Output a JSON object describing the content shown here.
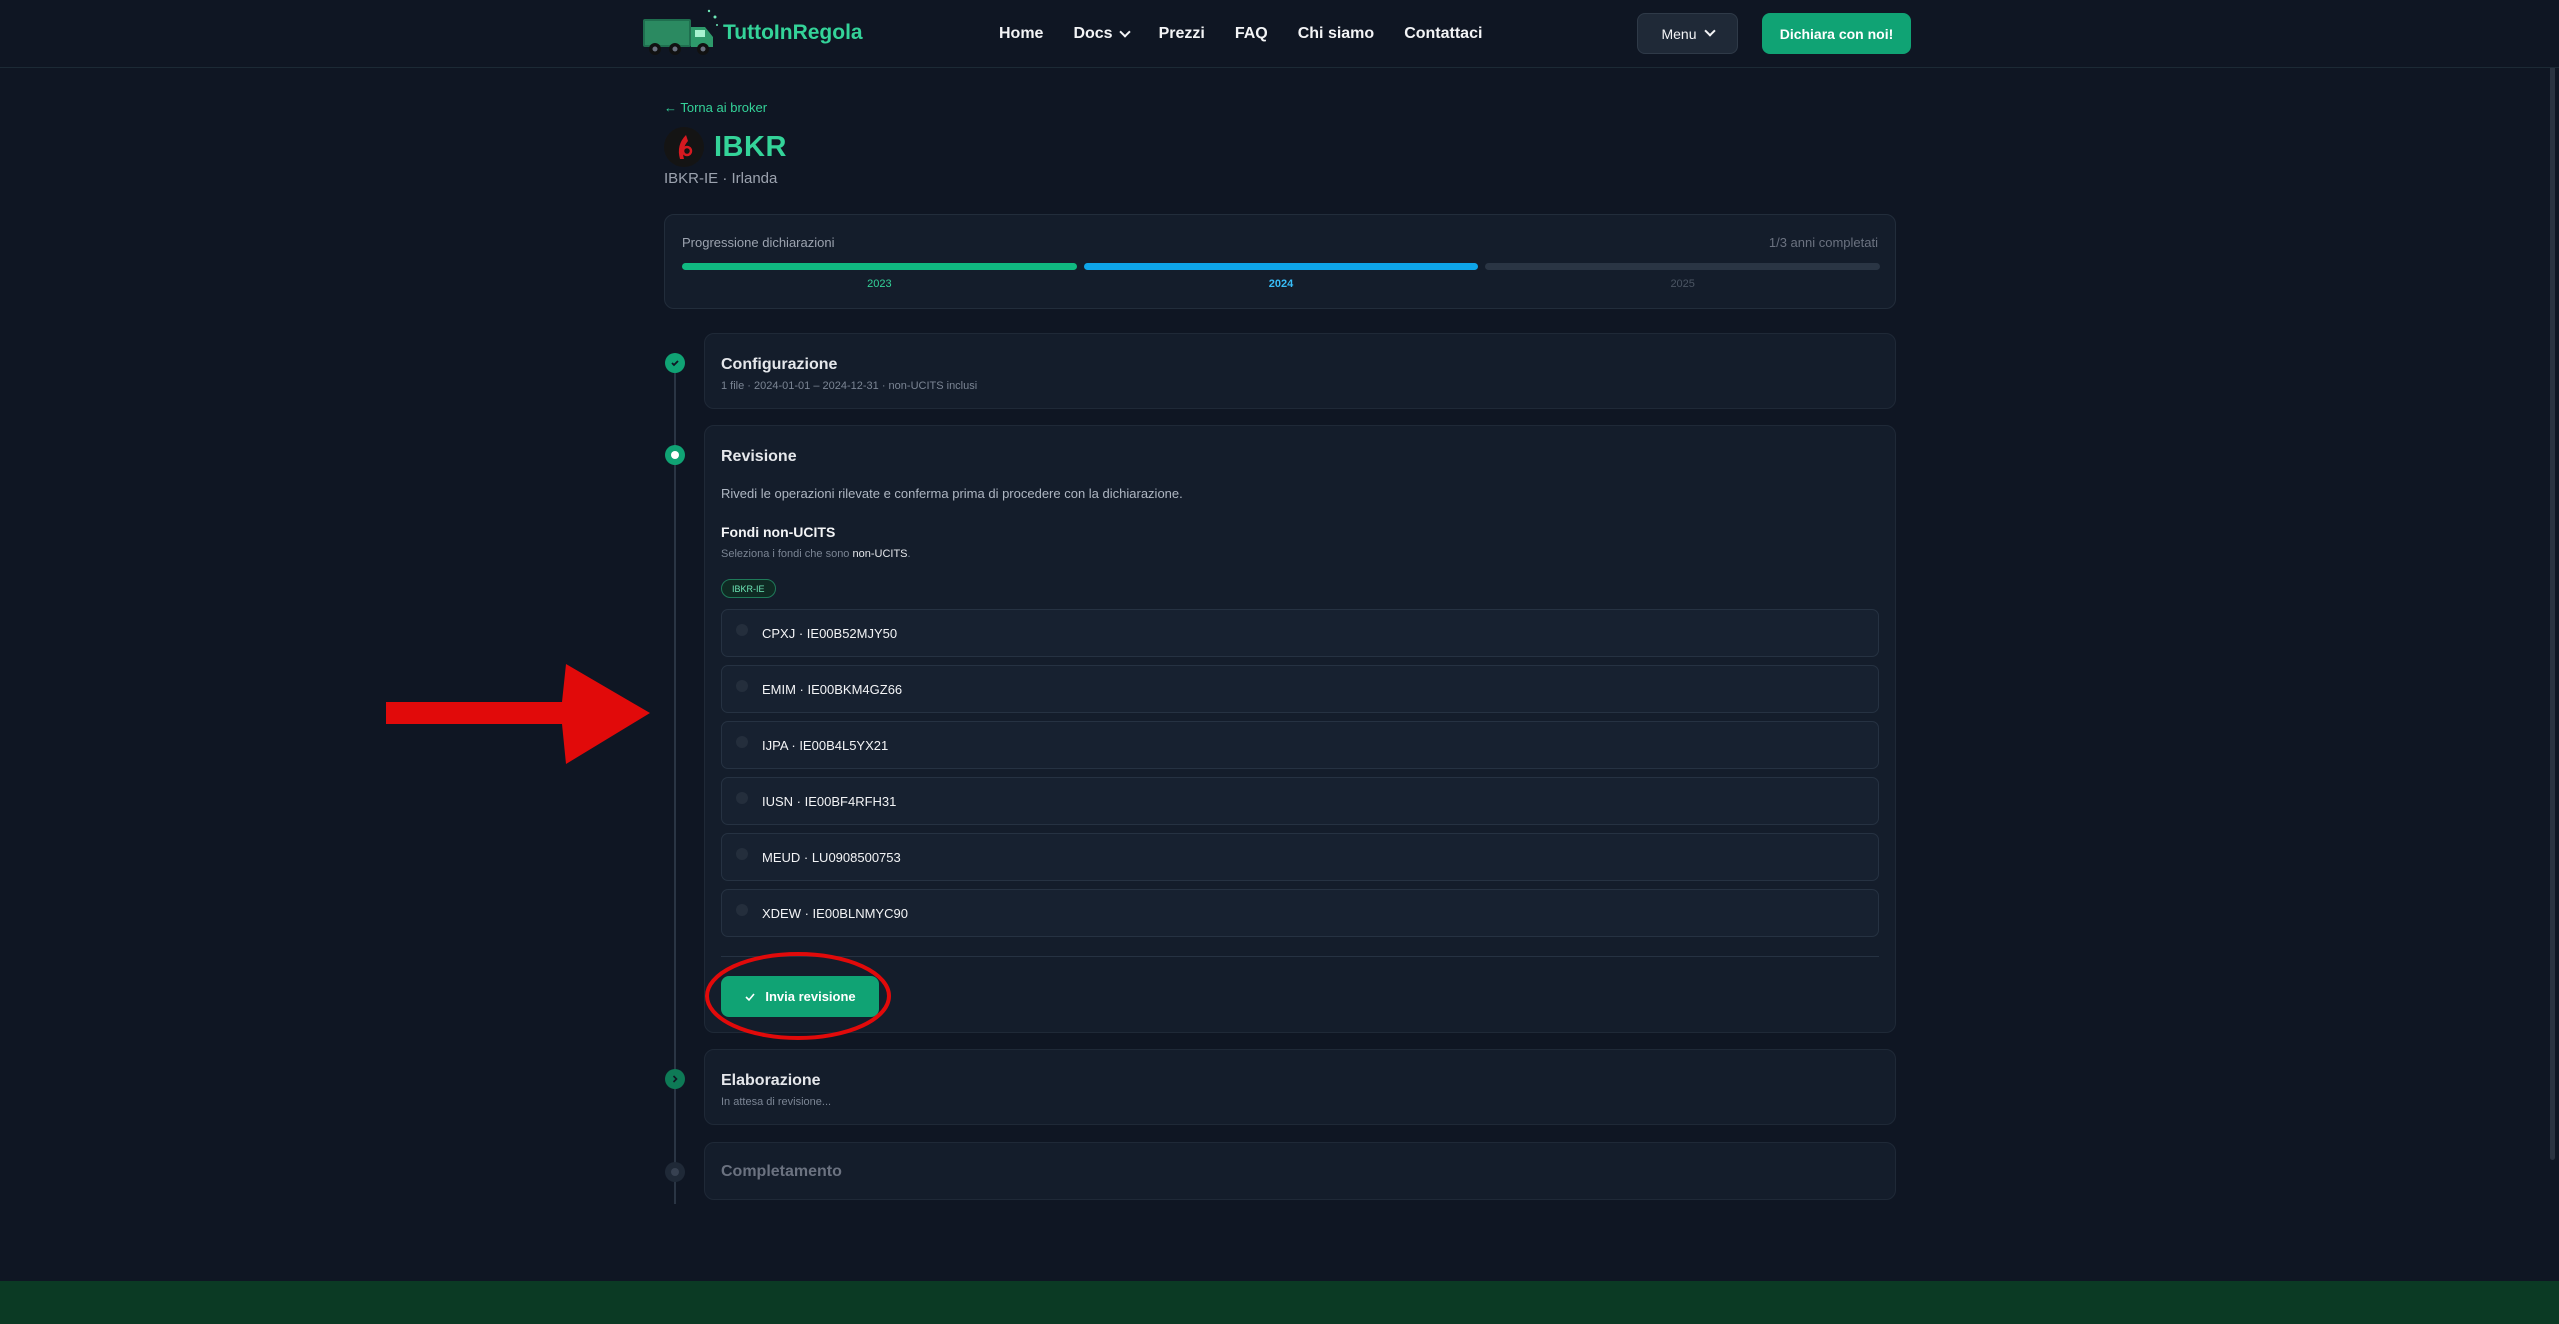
{
  "header": {
    "logo_text": "TuttoInRegola",
    "nav": [
      {
        "label": "Home"
      },
      {
        "label": "Docs",
        "dropdown": true
      },
      {
        "label": "Prezzi"
      },
      {
        "label": "FAQ"
      },
      {
        "label": "Chi siamo"
      },
      {
        "label": "Contattaci"
      }
    ],
    "menu_label": "Menu",
    "cta_label": "Dichiara con noi!"
  },
  "page": {
    "back_link": "← Torna ai broker",
    "broker_name": "IBKR",
    "broker_subtitle": "IBKR-IE · Irlanda"
  },
  "progress": {
    "label": "Progressione dichiarazioni",
    "count": "1/3 anni completati",
    "years": [
      {
        "year": "2023",
        "status": "completed",
        "color": "#10b981"
      },
      {
        "year": "2024",
        "status": "current",
        "color": "#0ea5e9"
      },
      {
        "year": "2025",
        "status": "pending",
        "color": "#2a3544"
      }
    ]
  },
  "steps": {
    "config": {
      "title": "Configurazione",
      "subtitle": "1 file · 2024-01-01 – 2024-12-31 · non-UCITS inclusi"
    },
    "review": {
      "title": "Revisione",
      "description": "Rivedi le operazioni rilevate e conferma prima di procedere con la dichiarazione.",
      "section_title": "Fondi non-UCITS",
      "section_hint_prefix": "Seleziona i fondi che sono ",
      "section_hint_bold": "non-UCITS",
      "section_hint_suffix": ".",
      "broker_tag": "IBKR-IE",
      "funds": [
        {
          "label": "CPXJ · IE00B52MJY50",
          "checked": false
        },
        {
          "label": "EMIM · IE00BKM4GZ66",
          "checked": false
        },
        {
          "label": "IJPA · IE00B4L5YX21",
          "checked": false
        },
        {
          "label": "IUSN · IE00BF4RFH31",
          "checked": false
        },
        {
          "label": "MEUD · LU0908500753",
          "checked": false
        },
        {
          "label": "XDEW · IE00BLNMYC90",
          "checked": false
        }
      ],
      "submit_label": "Invia revisione"
    },
    "processing": {
      "title": "Elaborazione",
      "subtitle": "In attesa di revisione..."
    },
    "completion": {
      "title": "Completamento"
    }
  },
  "colors": {
    "accent": "#10a374",
    "annotation": "#e10a0a"
  }
}
